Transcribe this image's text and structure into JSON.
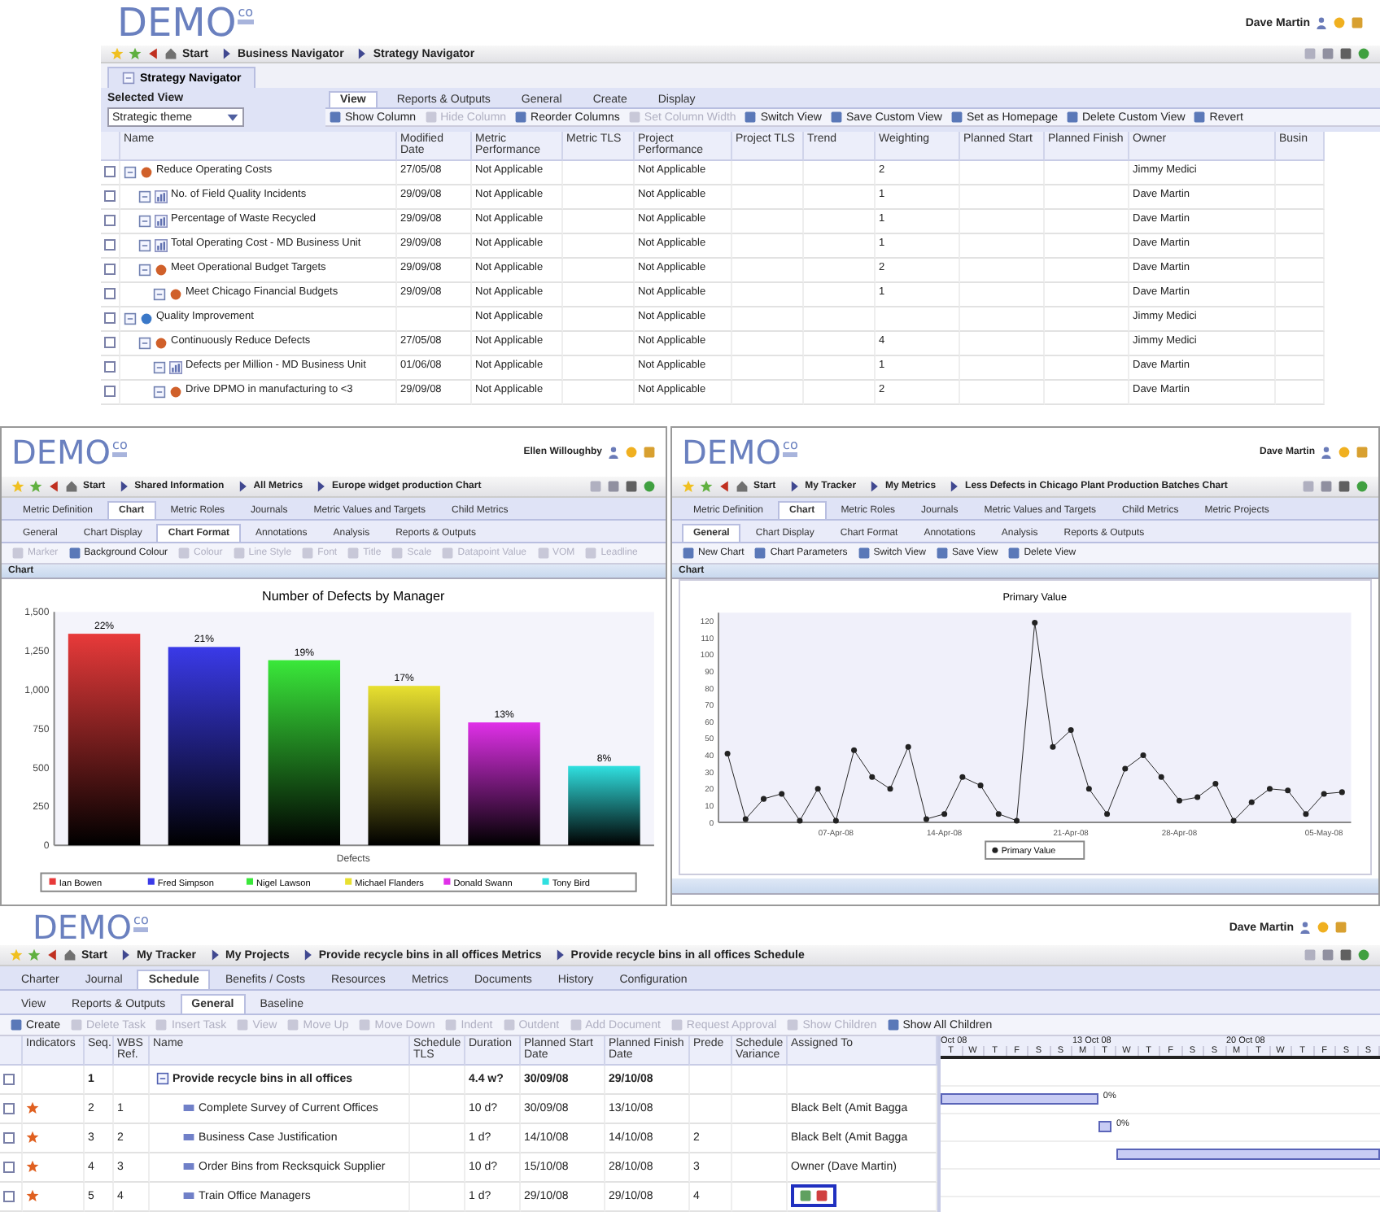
{
  "strategy_window": {
    "logo": {
      "text": "DEMO",
      "badge": "co"
    },
    "user": "Dave Martin",
    "breadcrumb": [
      "Start",
      "Business Navigator",
      "Strategy Navigator"
    ],
    "page_tab": "Strategy Navigator",
    "selected_view": {
      "label": "Selected View",
      "value": "Strategic theme"
    },
    "tabs": [
      {
        "label": "View",
        "selected": true
      },
      {
        "label": "Reports & Outputs",
        "selected": false
      },
      {
        "label": "General",
        "selected": false
      },
      {
        "label": "Create",
        "selected": false
      },
      {
        "label": "Display",
        "selected": false
      }
    ],
    "toolbar": [
      {
        "label": "Show Column",
        "disabled": false
      },
      {
        "label": "Hide Column",
        "disabled": true
      },
      {
        "label": "Reorder Columns",
        "disabled": false
      },
      {
        "label": "Set Column Width",
        "disabled": true
      },
      {
        "label": "Switch View",
        "disabled": false
      },
      {
        "label": "Save Custom View",
        "disabled": false
      },
      {
        "label": "Set as Homepage",
        "disabled": false
      },
      {
        "label": "Delete Custom View",
        "disabled": false
      },
      {
        "label": "Revert",
        "disabled": false
      }
    ],
    "columns": [
      "Name",
      "Modified Date",
      "Metric Performance",
      "Metric TLS",
      "Project Performance",
      "Project TLS",
      "Trend",
      "Weighting",
      "Planned Start",
      "Planned Finish",
      "Owner",
      "Busin"
    ],
    "rows": [
      {
        "kind": "objective",
        "name": "Reduce Operating Costs",
        "checked": false,
        "modified_date": "27/05/08",
        "metric_performance": "Not Applicable",
        "project_performance": "Not Applicable",
        "weighting": "2",
        "owner": "Jimmy Medici",
        "children": [
          {
            "kind": "metric",
            "name": "No. of Field Quality Incidents",
            "checked": false,
            "modified_date": "29/09/08",
            "metric_performance": "Not Applicable",
            "project_performance": "Not Applicable",
            "weighting": "1",
            "owner": "Dave Martin"
          },
          {
            "kind": "metric",
            "name": "Percentage of Waste Recycled",
            "checked": false,
            "modified_date": "29/09/08",
            "metric_performance": "Not Applicable",
            "project_performance": "Not Applicable",
            "weighting": "1",
            "owner": "Dave Martin"
          },
          {
            "kind": "metric",
            "name": "Total Operating Cost - MD Business Unit",
            "checked": false,
            "modified_date": "29/09/08",
            "metric_performance": "Not Applicable",
            "project_performance": "Not Applicable",
            "weighting": "1",
            "owner": "Dave Martin"
          },
          {
            "kind": "objective",
            "name": "Meet Operational Budget Targets",
            "checked": false,
            "modified_date": "29/09/08",
            "metric_performance": "Not Applicable",
            "project_performance": "Not Applicable",
            "weighting": "2",
            "owner": "Dave Martin",
            "children": [
              {
                "kind": "objective",
                "name": "Meet Chicago Financial Budgets",
                "checked": false,
                "modified_date": "29/09/08",
                "metric_performance": "Not Applicable",
                "project_performance": "Not Applicable",
                "weighting": "1",
                "owner": "Dave Martin"
              }
            ]
          }
        ]
      },
      {
        "kind": "theme",
        "name": "Quality Improvement",
        "checked": false,
        "metric_performance": "Not Applicable",
        "project_performance": "Not Applicable",
        "owner": "Jimmy Medici",
        "children": [
          {
            "kind": "objective",
            "name": "Continuously Reduce Defects",
            "checked": false,
            "modified_date": "27/05/08",
            "metric_performance": "Not Applicable",
            "project_performance": "Not Applicable",
            "weighting": "4",
            "owner": "Jimmy Medici",
            "children": [
              {
                "kind": "metric",
                "name": "Defects per Million - MD Business Unit",
                "checked": false,
                "modified_date": "01/06/08",
                "metric_performance": "Not Applicable",
                "project_performance": "Not Applicable",
                "weighting": "1",
                "owner": "Dave Martin"
              },
              {
                "kind": "objective",
                "name": "Drive DPMO in manufacturing to <3",
                "checked": false,
                "modified_date": "29/09/08",
                "metric_performance": "Not Applicable",
                "project_performance": "Not Applicable",
                "weighting": "2",
                "owner": "Dave Martin"
              }
            ]
          }
        ]
      }
    ]
  },
  "defects_chart_window": {
    "logo": {
      "text": "DEMO",
      "badge": "co"
    },
    "user": "Ellen Willoughby",
    "breadcrumb": [
      "Start",
      "Shared Information",
      "All Metrics",
      "Europe widget production Chart"
    ],
    "tabs": [
      {
        "label": "Metric Definition",
        "selected": false
      },
      {
        "label": "Chart",
        "selected": true
      },
      {
        "label": "Metric Roles",
        "selected": false
      },
      {
        "label": "Journals",
        "selected": false
      },
      {
        "label": "Metric Values and Targets",
        "selected": false
      },
      {
        "label": "Child Metrics",
        "selected": false
      }
    ],
    "subtabs": [
      {
        "label": "General",
        "selected": false
      },
      {
        "label": "Chart Display",
        "selected": false
      },
      {
        "label": "Chart Format",
        "selected": true
      },
      {
        "label": "Annotations",
        "selected": false
      },
      {
        "label": "Analysis",
        "selected": false
      },
      {
        "label": "Reports & Outputs",
        "selected": false
      }
    ],
    "toolbar": [
      {
        "label": "Marker",
        "disabled": true
      },
      {
        "label": "Background Colour",
        "disabled": false
      },
      {
        "label": "Colour",
        "disabled": true
      },
      {
        "label": "Line Style",
        "disabled": true
      },
      {
        "label": "Font",
        "disabled": true
      },
      {
        "label": "Title",
        "disabled": true
      },
      {
        "label": "Scale",
        "disabled": true
      },
      {
        "label": "Datapoint Value",
        "disabled": true
      },
      {
        "label": "VOM",
        "disabled": true
      },
      {
        "label": "Leadline",
        "disabled": true
      }
    ],
    "panel_title": "Chart",
    "chart_data": {
      "type": "bar",
      "title": "Number of Defects by Manager",
      "categories": [
        "Defects"
      ],
      "series": [
        {
          "name": "Ian Bowen",
          "color": "#e83a3a",
          "values": [
            1360
          ]
        },
        {
          "name": "Fred Simpson",
          "color": "#3a3ae8",
          "values": [
            1275
          ]
        },
        {
          "name": "Nigel Lawson",
          "color": "#3ae83a",
          "values": [
            1190
          ]
        },
        {
          "name": "Michael Flanders",
          "color": "#e8e030",
          "values": [
            1025
          ]
        },
        {
          "name": "Donald Swann",
          "color": "#e030e8",
          "values": [
            790
          ]
        },
        {
          "name": "Tony Bird",
          "color": "#30e0e0",
          "values": [
            510
          ]
        }
      ],
      "value_labels": [
        "22%",
        "21%",
        "19%",
        "17%",
        "13%",
        "8%"
      ],
      "legend": "bottom",
      "ylim": [
        0,
        1500
      ],
      "yticks": [
        0,
        250,
        500,
        750,
        {
          "value": 1000,
          "label": "1,000"
        },
        {
          "value": 1250,
          "label": "1,250"
        },
        {
          "value": 1500,
          "label": "1,500"
        }
      ]
    }
  },
  "batches_chart_window": {
    "logo": {
      "text": "DEMO",
      "badge": "co"
    },
    "user": "Dave Martin",
    "breadcrumb": [
      "Start",
      "My Tracker",
      "My Metrics",
      "Less Defects in Chicago Plant Production Batches Chart"
    ],
    "tabs": [
      {
        "label": "Metric Definition",
        "selected": false
      },
      {
        "label": "Chart",
        "selected": true
      },
      {
        "label": "Metric Roles",
        "selected": false
      },
      {
        "label": "Journals",
        "selected": false
      },
      {
        "label": "Metric Values and Targets",
        "selected": false
      },
      {
        "label": "Child Metrics",
        "selected": false
      },
      {
        "label": "Metric Projects",
        "selected": false
      }
    ],
    "subtabs": [
      {
        "label": "General",
        "selected": true
      },
      {
        "label": "Chart Display",
        "selected": false
      },
      {
        "label": "Chart Format",
        "selected": false
      },
      {
        "label": "Annotations",
        "selected": false
      },
      {
        "label": "Analysis",
        "selected": false
      },
      {
        "label": "Reports & Outputs",
        "selected": false
      }
    ],
    "toolbar": [
      {
        "label": "New Chart",
        "disabled": false
      },
      {
        "label": "Chart Parameters",
        "disabled": false
      },
      {
        "label": "Switch View",
        "disabled": false
      },
      {
        "label": "Save View",
        "disabled": false
      },
      {
        "label": "Delete View",
        "disabled": false
      }
    ],
    "panel_title": "Chart",
    "chart_data": {
      "type": "line",
      "title": "Primary Value",
      "series": [
        {
          "name": "Primary Value",
          "color": "#222222",
          "marker": "circle",
          "values": [
            41,
            2,
            14,
            17,
            1,
            20,
            1,
            43,
            27,
            20,
            45,
            2,
            5,
            27,
            22,
            5,
            1,
            119,
            45,
            55,
            20,
            5,
            32,
            40,
            27,
            13,
            15,
            23,
            1,
            12,
            20,
            19,
            5,
            17,
            18
          ]
        }
      ],
      "categories": [
        null,
        null,
        null,
        null,
        null,
        null,
        "07-Apr-08",
        null,
        null,
        null,
        null,
        null,
        "14-Apr-08",
        null,
        null,
        null,
        null,
        null,
        null,
        "21-Apr-08",
        null,
        null,
        null,
        null,
        null,
        "28-Apr-08",
        null,
        null,
        null,
        null,
        null,
        null,
        null,
        "05-May-08",
        null
      ],
      "ylim": [
        0,
        125
      ],
      "legend": "bottom",
      "yticks": [
        0,
        10,
        20,
        30,
        40,
        50,
        60,
        70,
        80,
        90,
        100,
        110,
        120
      ]
    }
  },
  "schedule_window": {
    "logo": {
      "text": "DEMO",
      "badge": "co"
    },
    "user": "Dave Martin",
    "breadcrumb": [
      "Start",
      "My Tracker",
      "My Projects",
      "Provide recycle bins in all offices Metrics",
      "Provide recycle bins in all offices Schedule"
    ],
    "tabs": [
      {
        "label": "Charter",
        "selected": false
      },
      {
        "label": "Journal",
        "selected": false
      },
      {
        "label": "Schedule",
        "selected": true
      },
      {
        "label": "Benefits / Costs",
        "selected": false
      },
      {
        "label": "Resources",
        "selected": false
      },
      {
        "label": "Metrics",
        "selected": false
      },
      {
        "label": "Documents",
        "selected": false
      },
      {
        "label": "History",
        "selected": false
      },
      {
        "label": "Configuration",
        "selected": false
      }
    ],
    "subtabs": [
      {
        "label": "View",
        "selected": false
      },
      {
        "label": "Reports & Outputs",
        "selected": false
      },
      {
        "label": "General",
        "selected": true
      },
      {
        "label": "Baseline",
        "selected": false
      }
    ],
    "toolbar": [
      {
        "label": "Create",
        "disabled": false
      },
      {
        "label": "Delete Task",
        "disabled": true
      },
      {
        "label": "Insert Task",
        "disabled": true
      },
      {
        "label": "View",
        "disabled": true
      },
      {
        "label": "Move Up",
        "disabled": true
      },
      {
        "label": "Move Down",
        "disabled": true
      },
      {
        "label": "Indent",
        "disabled": true
      },
      {
        "label": "Outdent",
        "disabled": true
      },
      {
        "label": "Add Document",
        "disabled": true
      },
      {
        "label": "Request Approval",
        "disabled": true
      },
      {
        "label": "Show Children",
        "disabled": true
      },
      {
        "label": "Show All Children",
        "disabled": false
      }
    ],
    "columns": [
      "Indicators",
      "Seq.",
      "WBS Ref.",
      "Name",
      "Schedule TLS",
      "Duration",
      "Planned Start Date",
      "Planned Finish Date",
      "Prede",
      "Schedule Variance",
      "Assigned To"
    ],
    "rows": [
      {
        "kind": "summary",
        "checked": false,
        "flagged": false,
        "seq": "1",
        "name": "Provide recycle bins in all offices",
        "duration": "4.4 w?",
        "planned_start": "30/09/08",
        "planned_finish": "29/10/08",
        "editing": false
      },
      {
        "kind": "task",
        "checked": false,
        "flagged": true,
        "seq": "2",
        "wbs": "1",
        "name": "Complete Survey of Current Offices",
        "duration": "10 d?",
        "planned_start": "30/09/08",
        "planned_finish": "13/10/08",
        "assigned_to": "Black Belt (Amit Bagga",
        "progress": "0%",
        "editing": false
      },
      {
        "kind": "task",
        "checked": false,
        "flagged": true,
        "seq": "3",
        "wbs": "2",
        "name": "Business Case Justification",
        "duration": "1 d?",
        "planned_start": "14/10/08",
        "planned_finish": "14/10/08",
        "predecessor": "2",
        "assigned_to": "Black Belt (Amit Bagga",
        "progress": "0%",
        "editing": false
      },
      {
        "kind": "task",
        "checked": false,
        "flagged": true,
        "seq": "4",
        "wbs": "3",
        "name": "Order Bins from Recksquick Supplier",
        "duration": "10 d?",
        "planned_start": "15/10/08",
        "planned_finish": "28/10/08",
        "predecessor": "3",
        "assigned_to": "Owner (Dave Martin)",
        "editing": false
      },
      {
        "kind": "task",
        "checked": false,
        "flagged": true,
        "seq": "5",
        "wbs": "4",
        "name": "Train Office Managers",
        "duration": "1 d?",
        "planned_start": "29/10/08",
        "planned_finish": "29/10/08",
        "predecessor": "4",
        "editing": true
      }
    ],
    "gantt": {
      "months": [
        "Oct 08",
        "13 Oct 08",
        "20 Oct 08"
      ],
      "days": [
        "T",
        "W",
        "T",
        "F",
        "S",
        "S",
        "M",
        "T",
        "W",
        "T",
        "F",
        "S",
        "S",
        "M",
        "T",
        "W",
        "T",
        "F",
        "S",
        "S"
      ]
    }
  }
}
